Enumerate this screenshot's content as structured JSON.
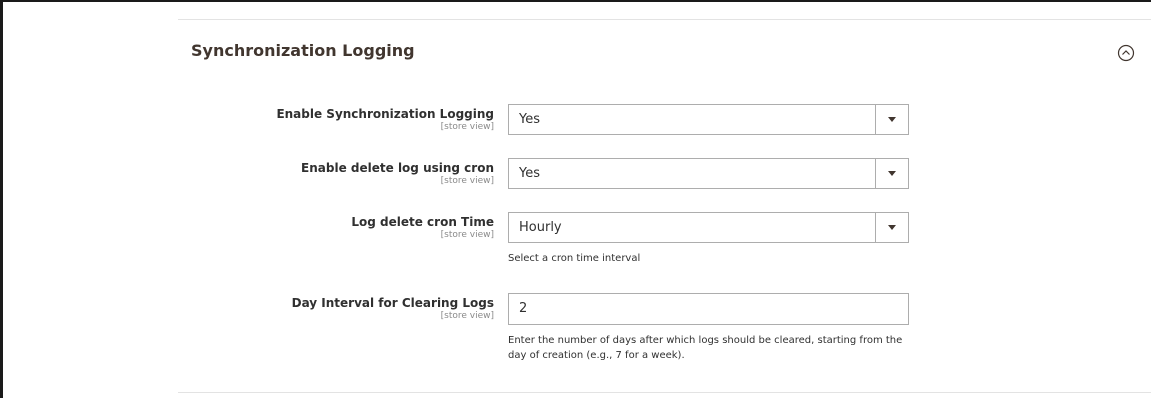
{
  "section": {
    "title": "Synchronization Logging"
  },
  "fields": [
    {
      "label": "Enable Synchronization Logging",
      "scope": "[store view]",
      "value": "Yes"
    },
    {
      "label": "Enable delete log using cron",
      "scope": "[store view]",
      "value": "Yes"
    },
    {
      "label": "Log delete cron Time",
      "scope": "[store view]",
      "value": "Hourly",
      "note": "Select a cron time interval"
    },
    {
      "label": "Day Interval for Clearing Logs",
      "scope": "[store view]",
      "value": "2",
      "note": "Enter the number of days after which logs should be cleared, starting from the day of creation (e.g., 7 for a week)."
    }
  ],
  "icons": {
    "collapse": "chevron-up-circle-icon",
    "select_arrow": "triangle-down-icon"
  },
  "colors": {
    "title": "#41362f",
    "border": "#adadad",
    "divider": "#e3e3e3",
    "scope": "#8a8a8a"
  }
}
